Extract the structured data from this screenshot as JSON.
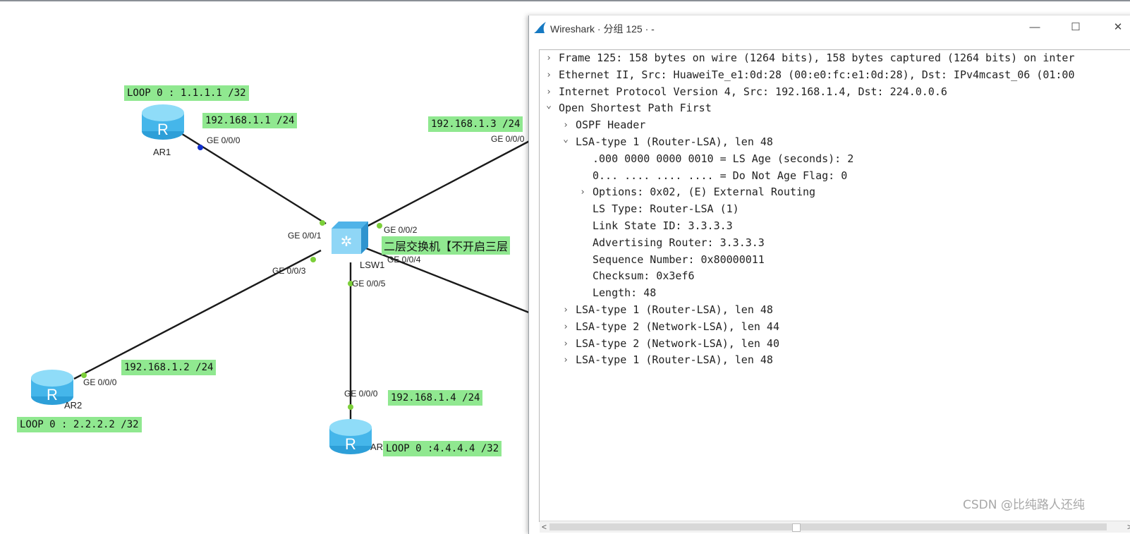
{
  "topology": {
    "devices": [
      {
        "id": "AR1",
        "name": "AR1"
      },
      {
        "id": "AR2",
        "name": "AR2"
      },
      {
        "id": "AR4",
        "name": "AR4"
      },
      {
        "id": "LSW1",
        "name": "LSW1"
      }
    ],
    "labels": {
      "ar1_loop": "LOOP 0 : 1.1.1.1 /32",
      "ar1_ip": "192.168.1.1 /24",
      "ar3_ip": "192.168.1.3 /24",
      "ar2_ip": "192.168.1.2 /24",
      "ar2_loop": "LOOP 0 : 2.2.2.2 /32",
      "ar4_ip": "192.168.1.4 /24",
      "ar4_loop": "LOOP 0 :4.4.4.4 /32",
      "switch_note": "二层交换机【不开启三层"
    },
    "ports": {
      "ar1_ge000": "GE 0/0/0",
      "ar3_ge000": "GE 0/0/0",
      "lsw_ge001": "GE 0/0/1",
      "lsw_ge002": "GE 0/0/2",
      "lsw_ge003": "GE 0/0/3",
      "lsw_ge004": "GE 0/0/4",
      "lsw_ge005": "GE 0/0/5",
      "ar2_ge000": "GE 0/0/0",
      "ar4_ge000": "GE 0/0/0"
    },
    "colors": {
      "label_bg": "#90e890",
      "link": "#1a1a1a",
      "port_dot": "#7ccf3a",
      "router": "#5cc4ef"
    }
  },
  "wireshark": {
    "title": "Wireshark · 分组 125 · -",
    "window_buttons": {
      "minimize": "—",
      "maximize": "☐",
      "close": "✕"
    },
    "tree": [
      {
        "indent": 0,
        "state": "collapsed",
        "text": "Frame 125: 158 bytes on wire (1264 bits), 158 bytes captured (1264 bits) on inter"
      },
      {
        "indent": 0,
        "state": "collapsed",
        "text": "Ethernet II, Src: HuaweiTe_e1:0d:28 (00:e0:fc:e1:0d:28), Dst: IPv4mcast_06 (01:00"
      },
      {
        "indent": 0,
        "state": "collapsed",
        "text": "Internet Protocol Version 4, Src: 192.168.1.4, Dst: 224.0.0.6"
      },
      {
        "indent": 0,
        "state": "expanded",
        "text": "Open Shortest Path First"
      },
      {
        "indent": 1,
        "state": "collapsed",
        "text": "OSPF Header"
      },
      {
        "indent": 1,
        "state": "expanded",
        "text": "LSA-type 1 (Router-LSA), len 48"
      },
      {
        "indent": 2,
        "state": "leaf",
        "text": ".000 0000 0000 0010 = LS Age (seconds): 2"
      },
      {
        "indent": 2,
        "state": "leaf",
        "text": "0... .... .... .... = Do Not Age Flag: 0"
      },
      {
        "indent": 2,
        "state": "collapsed",
        "text": "Options: 0x02, (E) External Routing"
      },
      {
        "indent": 2,
        "state": "leaf",
        "text": "LS Type: Router-LSA (1)"
      },
      {
        "indent": 2,
        "state": "leaf",
        "text": "Link State ID: 3.3.3.3"
      },
      {
        "indent": 2,
        "state": "leaf",
        "text": "Advertising Router: 3.3.3.3"
      },
      {
        "indent": 2,
        "state": "leaf",
        "text": "Sequence Number: 0x80000011"
      },
      {
        "indent": 2,
        "state": "leaf",
        "text": "Checksum: 0x3ef6"
      },
      {
        "indent": 2,
        "state": "leaf",
        "text": "Length: 48"
      },
      {
        "indent": 1,
        "state": "collapsed",
        "text": "LSA-type 1 (Router-LSA), len 48"
      },
      {
        "indent": 1,
        "state": "collapsed",
        "text": "LSA-type 2 (Network-LSA), len 44"
      },
      {
        "indent": 1,
        "state": "collapsed",
        "text": "LSA-type 2 (Network-LSA), len 40"
      },
      {
        "indent": 1,
        "state": "collapsed",
        "text": "LSA-type 1 (Router-LSA), len 48"
      }
    ],
    "scroll": {
      "left": "<",
      "right": ">"
    }
  },
  "watermark": "CSDN @比纯路人还纯"
}
